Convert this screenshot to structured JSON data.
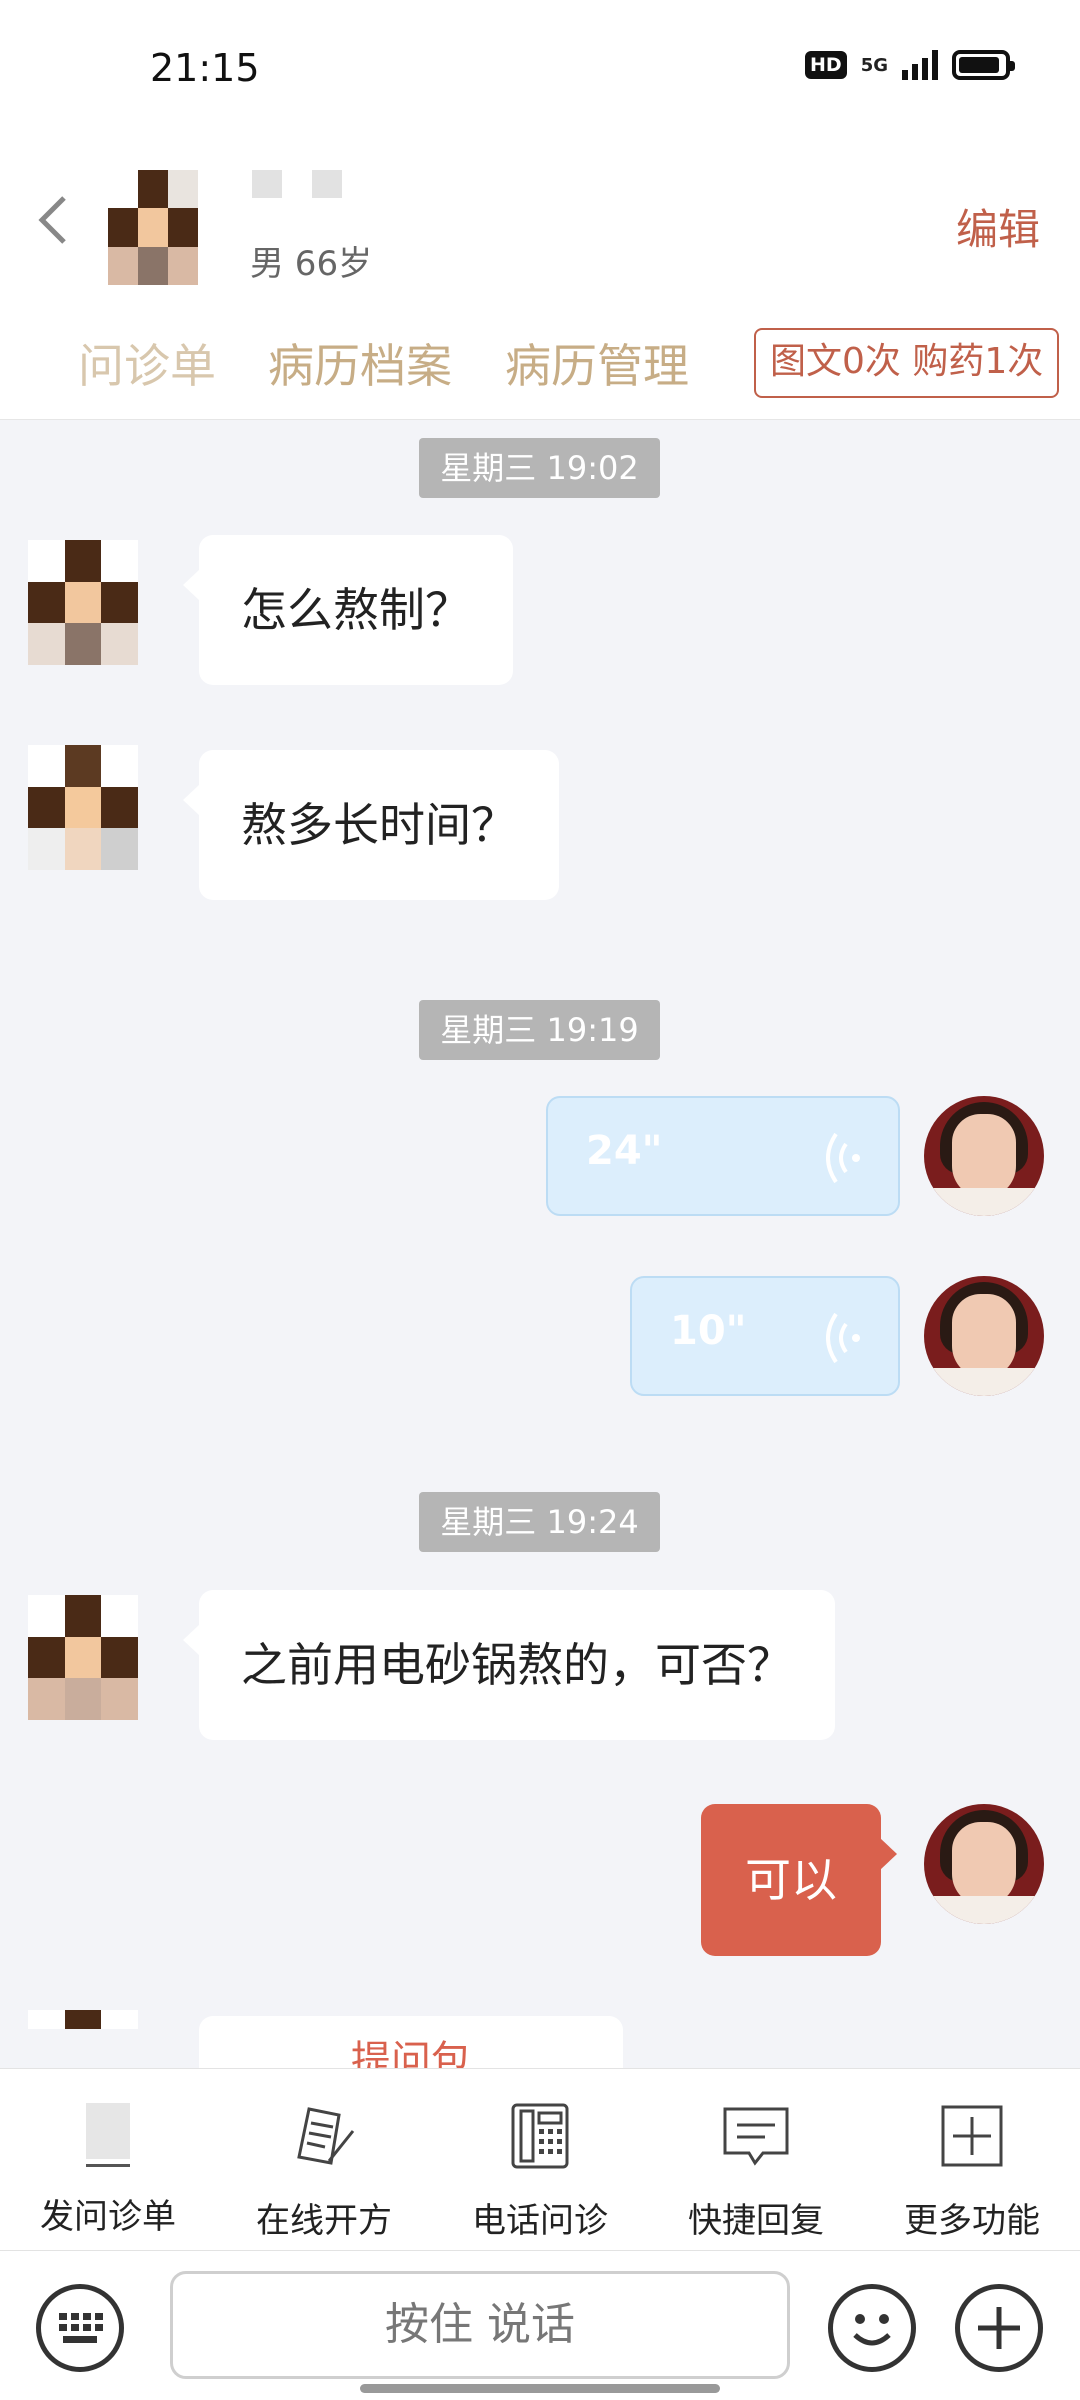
{
  "status_bar": {
    "time": "21:15",
    "hd": "HD",
    "network": "5G"
  },
  "header": {
    "patient_info": "男 66岁",
    "edit_label": "编辑",
    "tabs": [
      {
        "label": "问诊单"
      },
      {
        "label": "病历档案"
      },
      {
        "label": "病历管理"
      }
    ],
    "usage_badge": "图文0次 购药1次"
  },
  "chat": {
    "timestamps": [
      "星期三 19:02",
      "星期三 19:19",
      "星期三 19:24"
    ],
    "messages": [
      {
        "from": "patient",
        "text": "怎么熬制？"
      },
      {
        "from": "patient",
        "text": "熬多长时间？"
      },
      {
        "from": "doctor",
        "type": "voice",
        "duration": "24\""
      },
      {
        "from": "doctor",
        "type": "voice",
        "duration": "10\""
      },
      {
        "from": "patient",
        "text": "之前用电砂锅熬的，可否？"
      },
      {
        "from": "doctor",
        "text": "可以"
      },
      {
        "from": "patient",
        "text": "提问包"
      }
    ]
  },
  "toolbar": {
    "items": [
      {
        "label": "发问诊单",
        "icon": "questionnaire-icon"
      },
      {
        "label": "在线开方",
        "icon": "prescription-icon"
      },
      {
        "label": "电话问诊",
        "icon": "phone-icon"
      },
      {
        "label": "快捷回复",
        "icon": "quick-reply-icon"
      },
      {
        "label": "更多功能",
        "icon": "plus-square-icon"
      }
    ]
  },
  "input": {
    "hold_to_talk": "按住 说话"
  },
  "colors": {
    "accent": "#d9614d",
    "tab_text": "#c7ad86",
    "voice_bg": "#dceefc",
    "bg": "#f3f4f8"
  }
}
